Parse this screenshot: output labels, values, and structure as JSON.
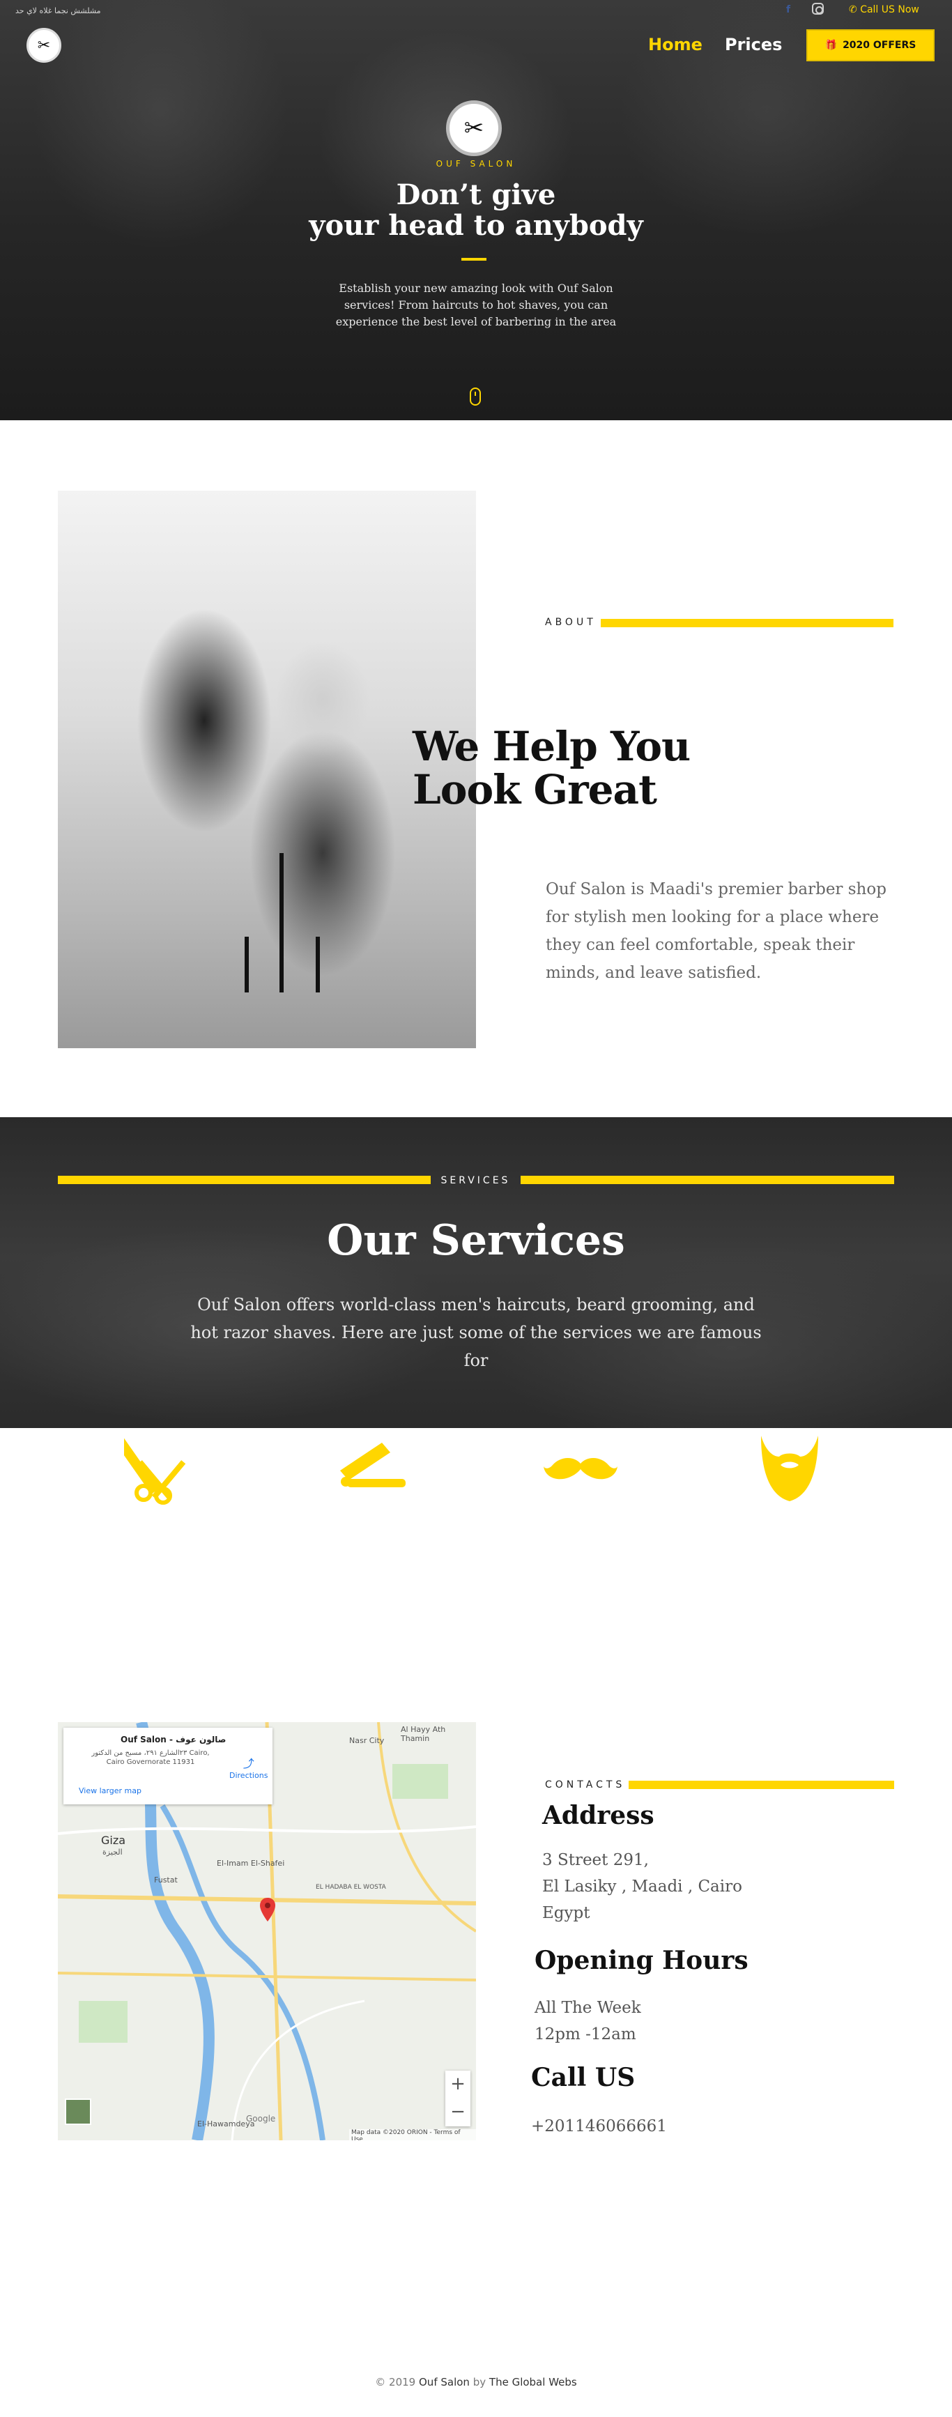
{
  "topbar": {
    "arabic_text": "مشلشش نجما غلاه لاي حد",
    "facebook_icon": "f",
    "instagram_icon": "instagram-icon",
    "call_label": "Call US Now"
  },
  "nav": {
    "home_label": "Home",
    "prices_label": "Prices",
    "offers_label": "2020 OFFERS"
  },
  "hero": {
    "brand": "OUF SALON",
    "title_line1": "Don’t give",
    "title_line2": "your head to anybody",
    "text": "Establish your new amazing look with Ouf Salon services! From haircuts to hot shaves, you can experience the best level of barbering in the area"
  },
  "about": {
    "label": "ABOUT",
    "title_line1": "We Help You",
    "title_line2": "Look Great",
    "text": "Ouf Salon is Maadi's premier barber shop for stylish men looking for a place where they can feel comfortable, speak their minds, and leave satisfied."
  },
  "services": {
    "label": "SERVICES",
    "title": "Our Services",
    "text": "Ouf Salon offers world-class men's haircuts, beard grooming, and hot razor shaves. Here are just some of the services we are famous for",
    "icons": [
      "scissors-comb-icon",
      "razor-icon",
      "mustache-icon",
      "beard-icon"
    ]
  },
  "map": {
    "place_title": "Ouf Salon - صالون عوف",
    "place_address": "٢٣الشارع ٢٩١، مسبح من الدكتور Cairo, Cairo Governorate 11931",
    "directions": "Directions",
    "larger_map": "View larger map",
    "label_giza": "Giza",
    "label_giza_ar": "الجيزة",
    "label_nasr": "Nasr City",
    "label_hawamdeya": "El-Hawamdeya",
    "label_fustat": "Fustat",
    "label_imam": "El-Imam El-Shafei",
    "label_al_hayy": "Al Hayy Ath Thamin",
    "label_harara": "EL HADABA EL WOSTA",
    "zoom_in": "+",
    "zoom_out": "−",
    "google": "Google",
    "attribution": "Map data ©2020 ORION - Terms of Use"
  },
  "contacts": {
    "label": "CONTACTS",
    "address_title": "Address",
    "address_line1": "3 Street 291,",
    "address_line2": "El Lasiky , Maadi , Cairo",
    "address_line3": "Egypt",
    "hours_title": "Opening Hours",
    "hours_line1": "All The Week",
    "hours_line2": "12pm -12am",
    "call_title": "Call US",
    "phone": "+201146066661"
  },
  "footer": {
    "prefix": "© 2019",
    "brand": "Ouf Salon",
    "by": "by",
    "company": "The Global Webs"
  },
  "colors": {
    "accent": "#ffd600",
    "dark": "#111111"
  }
}
